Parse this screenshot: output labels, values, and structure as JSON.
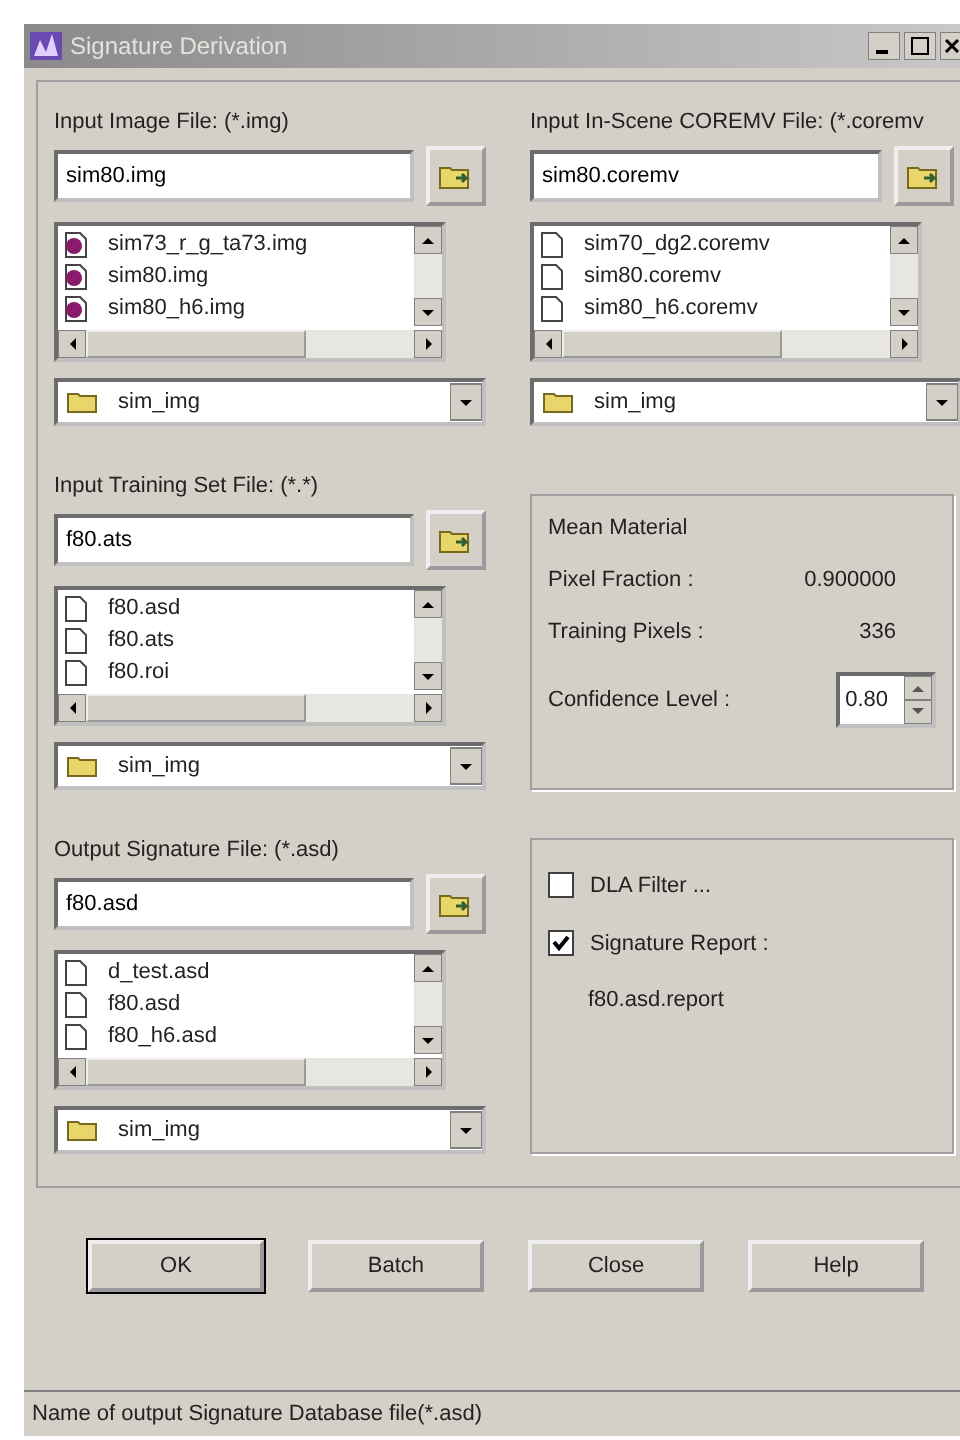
{
  "window": {
    "title": "Signature Derivation"
  },
  "pickers": [
    {
      "label": "Input Image File: (*.img)",
      "value": "sim80.img",
      "files": [
        {
          "name": "sim73_r_g_ta73.img",
          "kind": "image"
        },
        {
          "name": "sim80.img",
          "kind": "image"
        },
        {
          "name": "sim80_h6.img",
          "kind": "image"
        }
      ],
      "folder": "sim_img"
    },
    {
      "label": "Input In-Scene COREMV File: (*.coremv",
      "value": "sim80.coremv",
      "files": [
        {
          "name": "sim70_dg2.coremv",
          "kind": "document"
        },
        {
          "name": "sim80.coremv",
          "kind": "document"
        },
        {
          "name": "sim80_h6.coremv",
          "kind": "document"
        }
      ],
      "folder": "sim_img"
    },
    {
      "label": "Input Training Set File: (*.*)",
      "value": "f80.ats",
      "files": [
        {
          "name": "f80.asd",
          "kind": "document"
        },
        {
          "name": "f80.ats",
          "kind": "document"
        },
        {
          "name": "f80.roi",
          "kind": "document"
        }
      ],
      "folder": "sim_img"
    },
    {
      "label": "Output Signature File: (*.asd)",
      "value": "f80.asd",
      "files": [
        {
          "name": "d_test.asd",
          "kind": "document"
        },
        {
          "name": "f80.asd",
          "kind": "document"
        },
        {
          "name": "f80_h6.asd",
          "kind": "document"
        }
      ],
      "folder": "sim_img"
    }
  ],
  "mean_material": {
    "title": "Mean Material",
    "pixel_fraction_label": "Pixel Fraction :",
    "pixel_fraction": "0.900000",
    "training_pixels_label": "Training Pixels :",
    "training_pixels": "336",
    "confidence_label": "Confidence Level :",
    "confidence": "0.80"
  },
  "options": [
    {
      "label": "DLA Filter ...",
      "checked": false
    },
    {
      "label": "Signature Report :",
      "checked": true
    }
  ],
  "report_file": "f80.asd.report",
  "buttons": [
    "OK",
    "Batch",
    "Close",
    "Help"
  ],
  "status_bar": "Name of output Signature Database file(*.asd)"
}
